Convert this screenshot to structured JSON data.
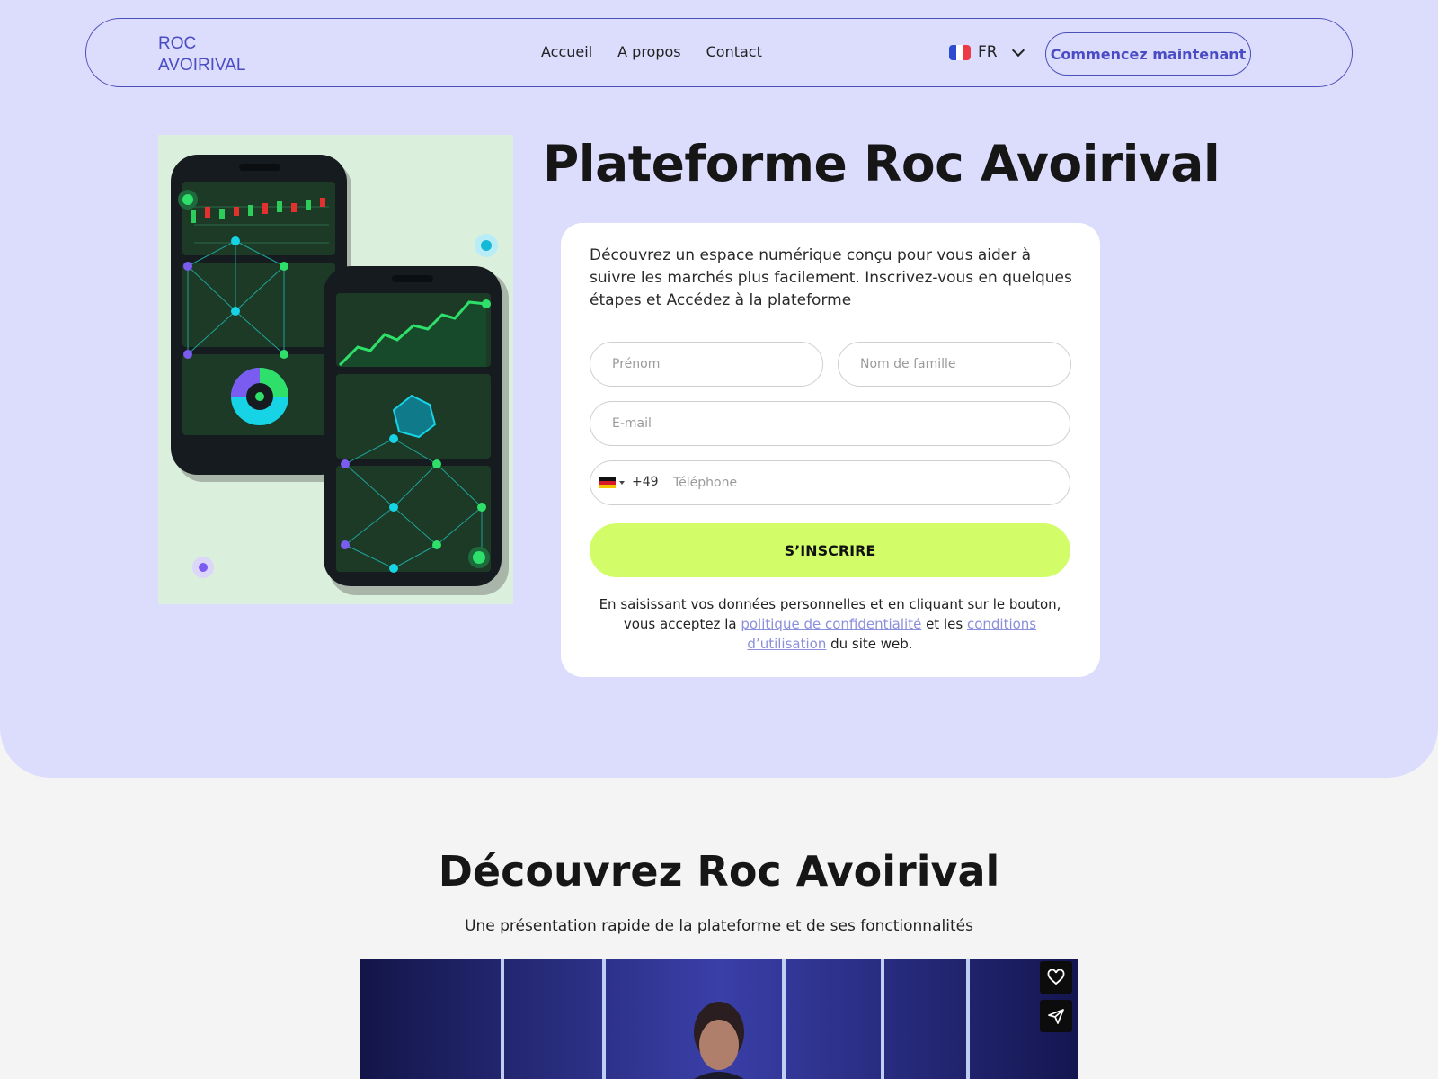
{
  "header": {
    "logo_line1": "ROC",
    "logo_line2": "AVOIRIVAL",
    "nav": [
      "Accueil",
      "A propos",
      "Contact"
    ],
    "language": "FR",
    "cta_label": "Commencez maintenant"
  },
  "hero": {
    "title": "Plateforme Roc Avoirival",
    "description": "Découvrez un espace numérique conçu pour vous aider à suivre les marchés plus facilement. Inscrivez-vous en quelques étapes et Accédez à la plateforme"
  },
  "form": {
    "first_name_placeholder": "Prénom",
    "last_name_placeholder": "Nom de famille",
    "email_placeholder": "E-mail",
    "phone_code": "+49",
    "phone_placeholder": "Téléphone",
    "submit_label": "S’INSCRIRE",
    "consent_prefix": "En saisissant vos données personnelles et en cliquant sur le bouton, vous acceptez la",
    "privacy_link": "politique de confidentialité",
    "consent_middle": "et les",
    "terms_link": "conditions d’utilisation",
    "consent_suffix": "du site web."
  },
  "discover": {
    "title": "Découvrez Roc Avoirival",
    "subtitle": "Une présentation rapide de la plateforme et de ses fonctionnalités"
  },
  "colors": {
    "hero_bg": "#dcdcfd",
    "accent": "#4a4cc4",
    "submit_bg": "#d2fd69",
    "link": "#8b8fdc"
  }
}
